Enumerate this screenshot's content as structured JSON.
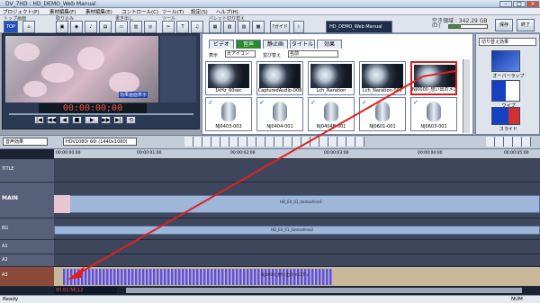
{
  "window": {
    "title": "DV_7HD : HD_DEMO_Web Manual"
  },
  "menu": [
    "プロジェクト(P)",
    "素材編集(F)",
    "素材編集(E)",
    "コントロール(C)",
    "ツール(T)",
    "設定(S)",
    "ヘルプ(H)"
  ],
  "toolbar": {
    "group_labels": [
      "トップ画面",
      "取り込み",
      "書き出し",
      "ツール",
      "パレット切り替え"
    ],
    "top_label": "TOP",
    "guide_label": "ガイド",
    "project_name": "HD_DEMO_Web Manual",
    "disk_label": "空き領域 : 342.29 GB",
    "disk_sub": "(D:)",
    "save_label": "保存",
    "exit_label": "終了"
  },
  "preview": {
    "overlay_text": "効果画面表示",
    "timecode": "00:00:00;00",
    "controls": [
      "|◀",
      "◀◀",
      "◀",
      "■",
      "▶",
      "▶▶",
      "▶|",
      "⟲"
    ]
  },
  "bin": {
    "tabs": [
      "ビデオ",
      "音声",
      "静止画",
      "タイトル",
      "効果"
    ],
    "view_label": "表示",
    "view_value": "大アイコン",
    "sort_label": "並び替え",
    "sort_value": "名前",
    "clips_row1": [
      "1kHz_60sec",
      "CapturedAudio-008",
      "Lch_Naration",
      "Lch_Naration-001",
      "NJ0000_想い出のメロディ"
    ],
    "clips_row2": [
      "NJ0403-003",
      "NJ0404-001",
      "NJ0404B-001",
      "NJ0601-001",
      "NJ0603-001"
    ]
  },
  "effects": {
    "dropdown": "切り替え効果",
    "items": [
      "オーバーラップ",
      "ワイプ",
      "スライド"
    ]
  },
  "timeline": {
    "track_type": "音声効果",
    "format": "HDV1080/ 60i (1440x1080)",
    "ruler": [
      "00:00:00:00",
      "00:00:01:00",
      "00:00:02:00",
      "00:00:03:00",
      "00:00:04:00",
      "00:00:05:00"
    ],
    "tracks": [
      "TITLE",
      "MAIN",
      "BG",
      "A1",
      "A2",
      "A3"
    ],
    "clip_main": "HD_EX_01_demoshine1",
    "clip_bg": "HD_EX_01_demoshine2",
    "clip_audio": "NJ0000_想い出のメロディ",
    "timecode": "00:01:56;12"
  },
  "status": {
    "left": "Ready",
    "right": "NUM"
  },
  "colors": {
    "accent": "#1440c4",
    "arrow": "#e02020",
    "waveform": "#5b4fe0"
  }
}
